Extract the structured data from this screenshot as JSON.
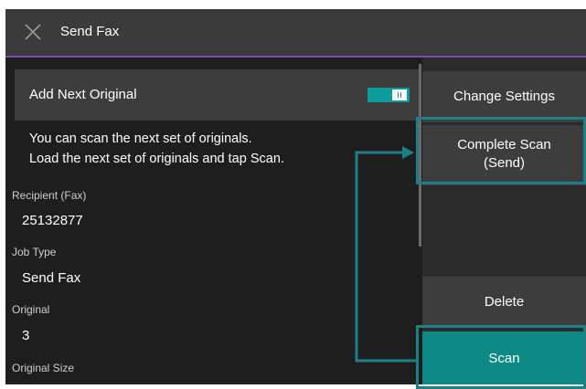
{
  "titlebar": {
    "title": "Send Fax",
    "close_icon": "close-icon"
  },
  "add_next_original": {
    "label": "Add Next Original",
    "toggle_state": "on",
    "toggle_color": "#0e9c9b"
  },
  "message": {
    "line1": "You can scan the next set of originals.",
    "line2": "Load the next set of originals and tap Scan."
  },
  "fields": [
    {
      "label": "Recipient (Fax)",
      "value": "25132877"
    },
    {
      "label": "Job Type",
      "value": "Send Fax"
    },
    {
      "label": "Original",
      "value": "3"
    },
    {
      "label": "Original Size",
      "value": ""
    }
  ],
  "buttons": {
    "change_settings": "Change Settings",
    "complete_scan_line1": "Complete Scan",
    "complete_scan_line2": "(Send)",
    "delete": "Delete",
    "scan": "Scan"
  },
  "colors": {
    "accent_teal": "#0d8a86",
    "titlebar_underline": "#7e4cb0",
    "highlight": "#1f7f86"
  }
}
